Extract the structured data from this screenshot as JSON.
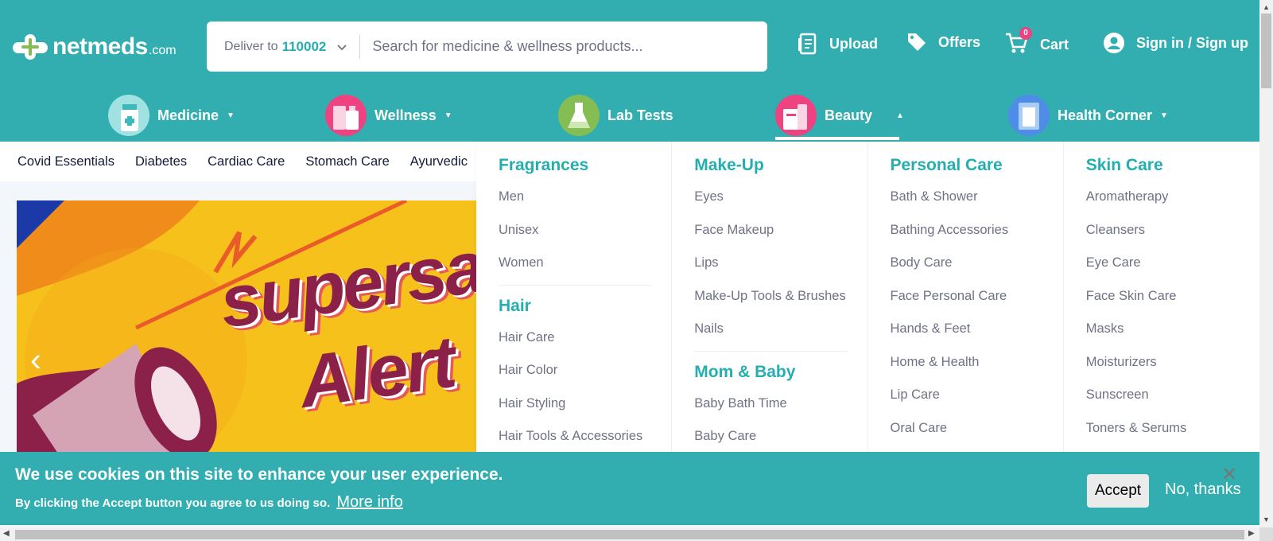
{
  "brand": {
    "name": "netmeds",
    "tld": ".com"
  },
  "search": {
    "deliver_prefix": "Deliver to",
    "pincode": "110002",
    "placeholder": "Search for medicine & wellness products..."
  },
  "header_nav": {
    "upload": "Upload",
    "offers": "Offers",
    "cart": "Cart",
    "cart_count": "0",
    "signin": "Sign in / Sign up"
  },
  "categories": [
    {
      "label": "Medicine",
      "icon": "medicine-bottle-icon"
    },
    {
      "label": "Wellness",
      "icon": "wellness-products-icon"
    },
    {
      "label": "Lab Tests",
      "icon": "lab-flask-icon"
    },
    {
      "label": "Beauty",
      "icon": "beauty-products-icon"
    },
    {
      "label": "Health Corner",
      "icon": "health-corner-icon"
    }
  ],
  "subnav": [
    "Covid Essentials",
    "Diabetes",
    "Cardiac Care",
    "Stomach Care",
    "Ayurvedic"
  ],
  "banner": {
    "line1": "supersa",
    "line2": "Alert"
  },
  "dropdown": {
    "col1": {
      "head1": "Fragrances",
      "items1": [
        "Men",
        "Unisex",
        "Women"
      ],
      "head2": "Hair",
      "items2": [
        "Hair Care",
        "Hair Color",
        "Hair Styling",
        "Hair Tools & Accessories"
      ]
    },
    "col2": {
      "head1": "Make-Up",
      "items1": [
        "Eyes",
        "Face Makeup",
        "Lips",
        "Make-Up Tools & Brushes",
        "Nails"
      ],
      "head2": "Mom & Baby",
      "items2": [
        "Baby Bath Time",
        "Baby Care"
      ]
    },
    "col3": {
      "head1": "Personal Care",
      "items1": [
        "Bath & Shower",
        "Bathing Accessories",
        "Body Care",
        "Face Personal Care",
        "Hands & Feet",
        "Home & Health",
        "Lip Care",
        "Oral Care"
      ]
    },
    "col4": {
      "head1": "Skin Care",
      "items1": [
        "Aromatherapy",
        "Cleansers",
        "Eye Care",
        "Face Skin Care",
        "Masks",
        "Moisturizers",
        "Sunscreen",
        "Toners & Serums"
      ]
    }
  },
  "cookie": {
    "title": "We use cookies on this site to enhance your user experience.",
    "subtitle": "By clicking the Accept button you agree to us doing so.",
    "more_info": "More info",
    "accept": "Accept",
    "decline": "No, thanks",
    "close": "✕"
  },
  "colors": {
    "brand": "#32aeb1",
    "accent_text": "#24aeb1",
    "badge": "#ef4281"
  }
}
